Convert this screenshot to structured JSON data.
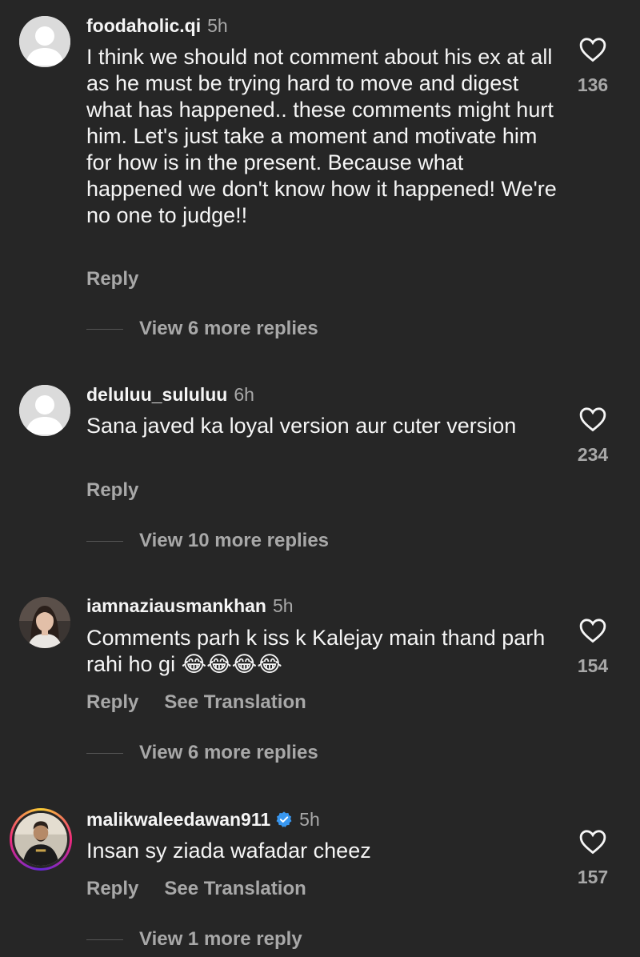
{
  "comments": [
    {
      "username": "foodaholic.qi",
      "time": "5h",
      "text": "I think we should not comment about his ex at all as he must be trying hard to move and digest what has happened.. these comments might hurt him. Let's just take a moment and motivate him for how is in the present. Because what happened we don't know how it happened! We're no one to judge!!",
      "likes": "136",
      "reply_label": "Reply",
      "view_replies": "View 6 more replies",
      "avatar": "default-avatar-icon"
    },
    {
      "username": "deluluu_sululuu",
      "time": "6h",
      "text": "Sana javed ka loyal version aur cuter version",
      "likes": "234",
      "reply_label": "Reply",
      "view_replies": "View 10 more replies",
      "avatar": "default-avatar-icon"
    },
    {
      "username": "iamnaziausmankhan",
      "time": "5h",
      "text": "Comments parh k iss k Kalejay main thand parh rahi ho gi 😂😂😂😂",
      "likes": "154",
      "reply_label": "Reply",
      "translate_label": "See Translation",
      "view_replies": "View 6 more replies",
      "avatar": "profile-photo"
    },
    {
      "username": "malikwaleedawan911",
      "time": "5h",
      "verified": true,
      "text": "Insan sy ziada wafadar cheez",
      "likes": "157",
      "reply_label": "Reply",
      "translate_label": "See Translation",
      "view_replies": "View 1 more reply",
      "avatar": "story-ring-profile-photo"
    }
  ],
  "colors": {
    "background": "#262626",
    "primary_text": "#f5f5f5",
    "secondary_text": "#a8a8a8",
    "verified_badge": "#3897f0"
  }
}
